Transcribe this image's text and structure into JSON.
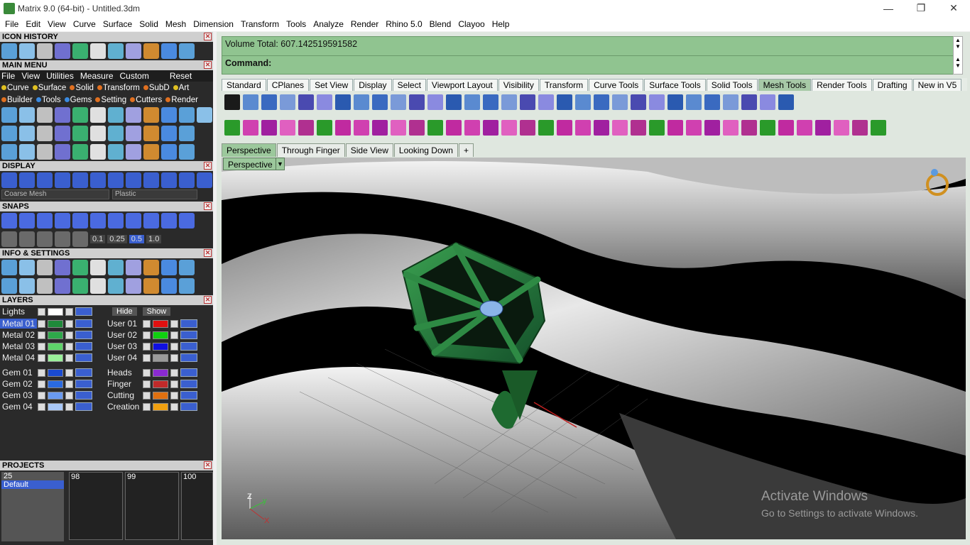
{
  "window": {
    "title": "Matrix 9.0 (64-bit) - Untitled.3dm",
    "minimize": "—",
    "restore": "❐",
    "close": "✕"
  },
  "menubar": [
    "File",
    "Edit",
    "View",
    "Curve",
    "Surface",
    "Solid",
    "Mesh",
    "Dimension",
    "Transform",
    "Tools",
    "Analyze",
    "Render",
    "Rhino 5.0",
    "Blend",
    "Clayoo",
    "Help"
  ],
  "left": {
    "icon_history": "ICON HISTORY",
    "main_menu": "MAIN MENU",
    "main_menu_items": [
      "File",
      "View",
      "Utilities",
      "Measure",
      "Custom",
      "Reset"
    ],
    "categories_row1": [
      {
        "label": "Curve",
        "color": "#e0c020"
      },
      {
        "label": "Surface",
        "color": "#e0c020"
      },
      {
        "label": "Solid",
        "color": "#e07020"
      },
      {
        "label": "Transform",
        "color": "#e07020"
      },
      {
        "label": "SubD",
        "color": "#e07020"
      },
      {
        "label": "Art",
        "color": "#e0c020"
      }
    ],
    "categories_row2": [
      {
        "label": "Builder",
        "color": "#e07020"
      },
      {
        "label": "Tools",
        "color": "#3a8ae0"
      },
      {
        "label": "Gems",
        "color": "#3a8ae0"
      },
      {
        "label": "Setting",
        "color": "#e07020"
      },
      {
        "label": "Cutters",
        "color": "#e07020"
      },
      {
        "label": "Render",
        "color": "#e07020"
      }
    ],
    "display": "DISPLAY",
    "display_mesh": "Coarse Mesh",
    "display_material": "Plastic",
    "snaps": "SNAPS",
    "snap_values": [
      "0.1",
      "0.25",
      "0.5",
      "1.0"
    ],
    "info_settings": "INFO & SETTINGS",
    "layers": "LAYERS",
    "lights": "Lights",
    "hide": "Hide",
    "show": "Show",
    "layers_left": [
      {
        "name": "Metal 01",
        "color": "#1f8a3a"
      },
      {
        "name": "Metal 02",
        "color": "#2ea84a"
      },
      {
        "name": "Metal 03",
        "color": "#5ed46a"
      },
      {
        "name": "Metal 04",
        "color": "#9af09a"
      },
      {
        "name": "Gem 01",
        "color": "#1a4ad0"
      },
      {
        "name": "Gem 02",
        "color": "#2a6ae0"
      },
      {
        "name": "Gem 03",
        "color": "#6a9af0"
      },
      {
        "name": "Gem 04",
        "color": "#a8c8f8"
      }
    ],
    "layers_right": [
      {
        "name": "User 01",
        "color": "#e01010"
      },
      {
        "name": "User 02",
        "color": "#10d010"
      },
      {
        "name": "User 03",
        "color": "#1010e0"
      },
      {
        "name": "User 04",
        "color": "#9a9a9a"
      },
      {
        "name": "Heads",
        "color": "#8a2ad0"
      },
      {
        "name": "Finger",
        "color": "#c02a2a"
      },
      {
        "name": "Cutting",
        "color": "#e07010"
      },
      {
        "name": "Creation",
        "color": "#f0a010"
      }
    ],
    "projects": "PROJECTS",
    "project_list": [
      "25",
      "Default"
    ],
    "thumbs": [
      "98",
      "99",
      "100"
    ]
  },
  "command": {
    "volume": "Volume Total: 607.142519591582",
    "prompt": "Command:"
  },
  "toolbar_tabs": [
    "Standard",
    "CPlanes",
    "Set View",
    "Display",
    "Select",
    "Viewport Layout",
    "Visibility",
    "Transform",
    "Curve Tools",
    "Surface Tools",
    "Solid Tools",
    "Mesh Tools",
    "Render Tools",
    "Drafting",
    "New in V5"
  ],
  "active_toolbar_tab": "Mesh Tools",
  "viewport_tabs": [
    "Perspective",
    "Through Finger",
    "Side View",
    "Looking Down"
  ],
  "viewport_label": "Perspective",
  "axes": {
    "z": "Z",
    "y": "y",
    "x": "X"
  },
  "watermark": {
    "line1": "Activate Windows",
    "line2": "Go to Settings to activate Windows."
  }
}
